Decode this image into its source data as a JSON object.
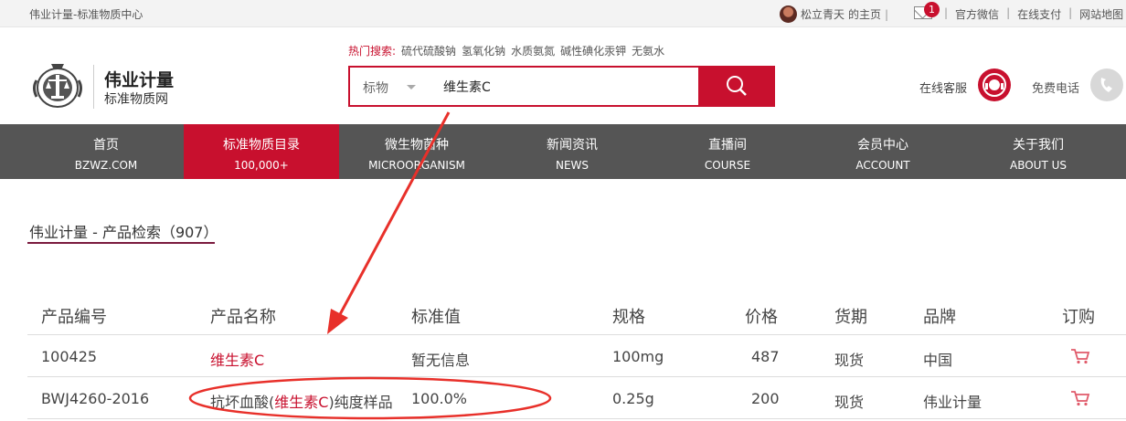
{
  "topbar": {
    "site_title": "伟业计量-标准物质中心",
    "user_name": "松立青天",
    "user_home": "的主页",
    "mail_count": "1",
    "links": [
      "官方微信",
      "在线支付",
      "网站地图"
    ]
  },
  "brand": {
    "name": "伟业计量",
    "subtitle": "标准物质网"
  },
  "hot_search": {
    "label": "热门搜索:",
    "items": [
      "硫代硫酸钠",
      "氢氧化钠",
      "水质氨氮",
      "碱性碘化汞钾",
      "无氨水"
    ]
  },
  "search": {
    "category": "标物",
    "query": "维生素C",
    "button_icon": "search-icon"
  },
  "service": {
    "online_label": "在线客服",
    "phone_label": "免费电话"
  },
  "nav": [
    {
      "cn": "首页",
      "en": "BZWZ.COM"
    },
    {
      "cn": "标准物质目录",
      "en": "100,000+"
    },
    {
      "cn": "微生物菌种",
      "en": "MICROORGANISM"
    },
    {
      "cn": "新闻资讯",
      "en": "NEWS"
    },
    {
      "cn": "直播间",
      "en": "COURSE"
    },
    {
      "cn": "会员中心",
      "en": "ACCOUNT"
    },
    {
      "cn": "关于我们",
      "en": "ABOUT US"
    }
  ],
  "breadcrumb": "伟业计量 - 产品检索（907）",
  "table": {
    "headers": [
      "产品编号",
      "产品名称",
      "标准值",
      "规格",
      "价格",
      "货期",
      "品牌",
      "订购"
    ],
    "rows": [
      {
        "code": "100425",
        "name_pre": "",
        "name_hl": "维生素C",
        "name_post": "",
        "std": "暂无信息",
        "spec": "100mg",
        "price": "487",
        "delivery": "现货",
        "brand": "中国"
      },
      {
        "code": "BWJ4260-2016",
        "name_pre": "抗坏血酸(",
        "name_hl": "维生素C",
        "name_post": ")纯度样品",
        "std": "100.0%",
        "spec": "0.25g",
        "price": "200",
        "delivery": "现货",
        "brand": "伟业计量"
      }
    ]
  },
  "colors": {
    "accent": "#c8102e",
    "nav_bg": "#555555",
    "annotation": "#e8302a"
  }
}
